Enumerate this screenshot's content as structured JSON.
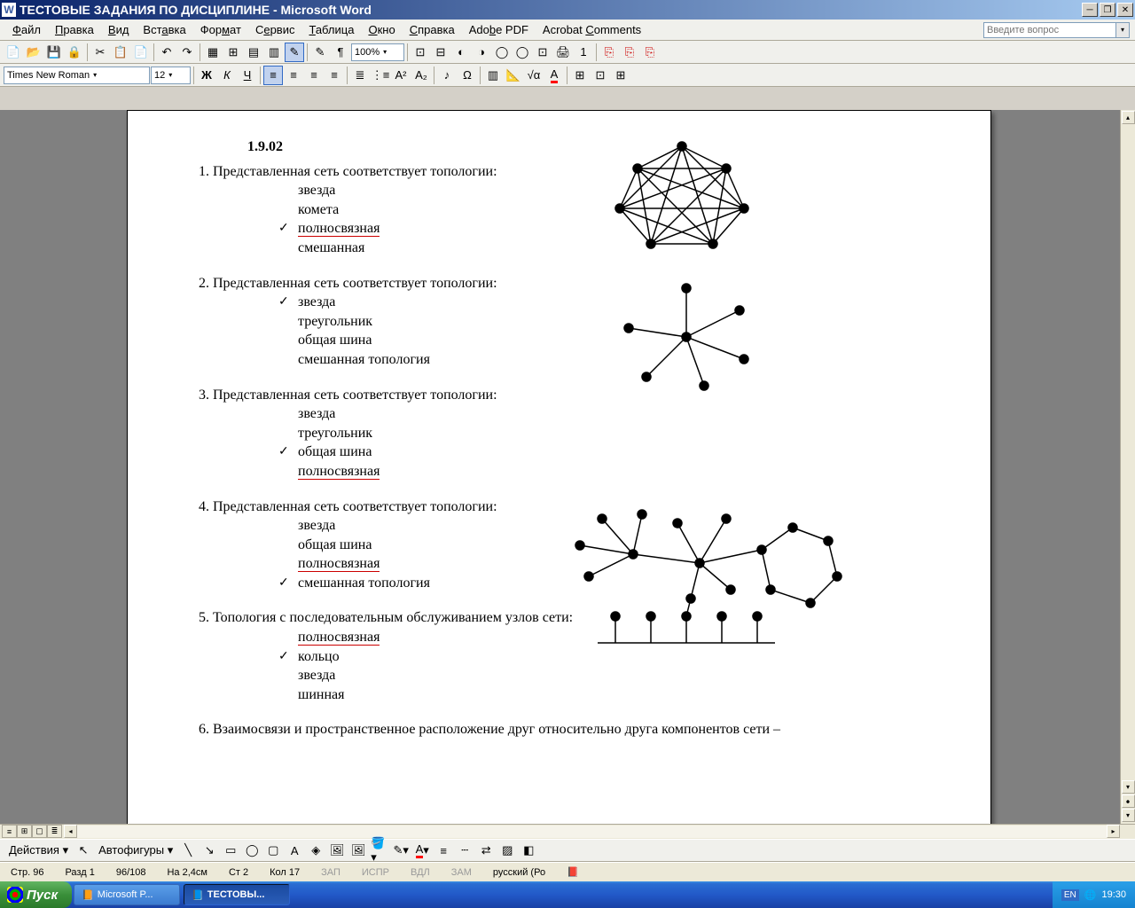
{
  "titlebar": {
    "title": "ТЕСТОВЫЕ ЗАДАНИЯ ПО ДИСЦИПЛИНЕ - Microsoft Word"
  },
  "menu": [
    "Файл",
    "Правка",
    "Вид",
    "Вставка",
    "Формат",
    "Сервис",
    "Таблица",
    "Окно",
    "Справка",
    "Adobe PDF",
    "Acrobat Comments"
  ],
  "helpPlaceholder": "Введите вопрос",
  "font": {
    "name": "Times New Roman",
    "size": "12"
  },
  "zoom": "100%",
  "doc": {
    "section": "1.9.02",
    "q1": {
      "text": "1. Представленная сеть соответствует топологии:",
      "opts": [
        "звезда",
        "комета",
        "полносвязная",
        "смешанная"
      ],
      "correct": 2,
      "underline": [
        2
      ]
    },
    "q2": {
      "text": "2. Представленная сеть соответствует топологии:",
      "opts": [
        "звезда",
        "треугольник",
        "общая шина",
        "смешанная топология"
      ],
      "correct": 0
    },
    "q3": {
      "text": "3. Представленная сеть соответствует топологии:",
      "opts": [
        "звезда",
        "треугольник",
        "общая шина",
        "полносвязная"
      ],
      "correct": 2,
      "underline": [
        3
      ]
    },
    "q4": {
      "text": "4. Представленная сеть соответствует топологии:",
      "opts": [
        "звезда",
        "общая шина",
        "полносвязная",
        "смешанная топология"
      ],
      "correct": 3,
      "underline": [
        2
      ]
    },
    "q5": {
      "text": "5. Топология с последовательным обслуживанием узлов сети:",
      "opts": [
        "полносвязная",
        "кольцо",
        "звезда",
        "шинная"
      ],
      "correct": 1,
      "underline": [
        0
      ]
    },
    "q6": {
      "text": "6. Взаимосвязи и пространственное расположение друг относительно друга компонентов сети –"
    }
  },
  "drawbar": {
    "actions": "Действия",
    "autoshapes": "Автофигуры"
  },
  "status": {
    "page": "Стр. 96",
    "section": "Разд 1",
    "pages": "96/108",
    "at": "На 2,4см",
    "line": "Ст 2",
    "col": "Кол 17",
    "rec": "ЗАП",
    "trk": "ИСПР",
    "ext": "ВДЛ",
    "ovr": "ЗАМ",
    "lang": "русский (Ро"
  },
  "taskbar": {
    "start": "Пуск",
    "tasks": [
      "Microsoft P...",
      "ТЕСТОВЫ..."
    ],
    "lang": "EN",
    "time": "19:30"
  }
}
